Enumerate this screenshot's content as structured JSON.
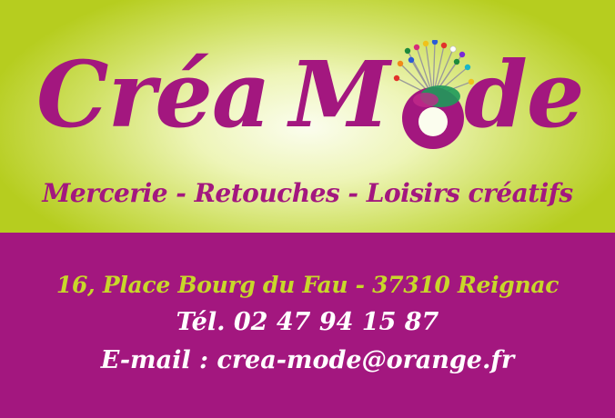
{
  "brand": {
    "word_left": "Créa",
    "word_m": "M",
    "word_right": "de",
    "icon": "pincushion-icon"
  },
  "tagline": "Mercerie - Retouches - Loisirs créatifs",
  "contact": {
    "address": "16, Place Bourg du Fau - 37310 Reignac",
    "phone_label": "Tél.",
    "phone": "02 47 94 15 87",
    "email_label": "E-mail :",
    "email": "crea-mode@orange.fr"
  },
  "colors": {
    "magenta": "#a3177f",
    "lime": "#b6cd1f",
    "lime_text": "#c8d72a",
    "white": "#ffffff"
  }
}
